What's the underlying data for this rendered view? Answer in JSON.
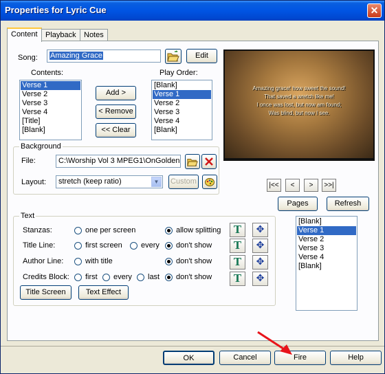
{
  "window": {
    "title": "Properties for Lyric Cue",
    "close_glyph": "✕"
  },
  "tabs": [
    "Content",
    "Playback",
    "Notes"
  ],
  "song": {
    "label": "Song:",
    "value": "Amazing Grace",
    "edit_label": "Edit",
    "browse_icon": "folder-open-icon"
  },
  "contents": {
    "label": "Contents:",
    "items": [
      "Verse 1",
      "Verse 2",
      "Verse 3",
      "Verse 4",
      "[Title]",
      "[Blank]"
    ],
    "selected": 0
  },
  "order_buttons": {
    "add": "Add >",
    "remove": "< Remove",
    "clear": "<< Clear"
  },
  "play_order": {
    "label": "Play Order:",
    "items": [
      "[Blank]",
      "Verse 1",
      "Verse 2",
      "Verse 3",
      "Verse 4",
      "[Blank]"
    ],
    "selected": 1
  },
  "preview": {
    "lines": [
      "Amazing grace! how sweet the sound!",
      "That saved a wretch like me!",
      "I once was lost, but now am found;",
      "Was blind, but now I see."
    ]
  },
  "background": {
    "group_label": "Background",
    "file_label": "File:",
    "file_value": "C:\\Worship Vol 3 MPEG1\\OnGolden",
    "layout_label": "Layout:",
    "layout_value": "stretch (keep ratio)",
    "custom_label": "Custom",
    "browse_icon": "folder-open-icon",
    "clear_icon": "red-x-icon",
    "palette_icon": "palette-icon"
  },
  "nav": {
    "first": "|<<",
    "prev": "<",
    "next": ">",
    "last": ">>|"
  },
  "pages_label": "Pages",
  "refresh_label": "Refresh",
  "text_group": {
    "label": "Text",
    "rows": [
      {
        "label": "Stanzas:",
        "options": [
          "one per screen",
          "allow splitting"
        ],
        "selected": 1
      },
      {
        "label": "Title Line:",
        "options": [
          "first screen",
          "every",
          "don't show"
        ],
        "selected": 2
      },
      {
        "label": "Author Line:",
        "options": [
          "with title",
          "don't show"
        ],
        "selected": 1
      },
      {
        "label": "Credits Block:",
        "options": [
          "first",
          "every",
          "last",
          "don't show"
        ],
        "selected": 3
      }
    ],
    "title_screen_label": "Title Screen",
    "text_effect_label": "Text Effect",
    "font_glyph": "T",
    "move_glyph": "✥"
  },
  "page_list": {
    "items": [
      "[Blank]",
      "Verse 1",
      "Verse 2",
      "Verse 3",
      "Verse 4",
      "[Blank]"
    ],
    "selected": 1
  },
  "footer": {
    "ok": "OK",
    "cancel": "Cancel",
    "fire": "Fire",
    "help": "Help"
  },
  "colors": {
    "selection": "#316ac5",
    "titlebar": "#0054e3",
    "annotation_arrow": "#e8141b"
  }
}
